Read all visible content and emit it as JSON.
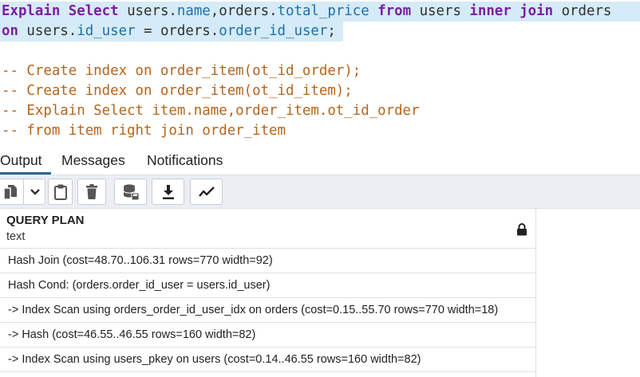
{
  "editor": {
    "line1": {
      "t1": "Explain Select",
      "t2": " users.",
      "t3": "name",
      "t4": ",orders.",
      "t5": "total_price",
      "t6": " ",
      "t7": "from",
      "t8": " users ",
      "t9": "inner join",
      "t10": " orders"
    },
    "line2": {
      "t1": "on",
      "t2": " users.",
      "t3": "id_user",
      "t4": " = orders.",
      "t5": "order_id_user",
      "t6": ";"
    },
    "comment1": "-- Create index on order_item(ot_id_order);",
    "comment2": "-- Create index on order_item(ot_id_item);",
    "comment3": "-- Explain Select item.name,order_item.ot_id_order",
    "comment4": "-- from item right join order_item"
  },
  "tabs": {
    "output": "Output",
    "messages": "Messages",
    "notifications": "Notifications"
  },
  "toolbar": {
    "icons": [
      "copy-icon",
      "chevron-down-icon",
      "paste-icon",
      "delete-icon",
      "save-data-icon",
      "download-icon",
      "graph-icon"
    ]
  },
  "grid": {
    "column": {
      "name": "QUERY PLAN",
      "type": "text"
    },
    "rows": [
      "Hash Join (cost=48.70..106.31 rows=770 width=92)",
      "Hash Cond: (orders.order_id_user = users.id_user)",
      "-> Index Scan using orders_order_id_user_idx on orders (cost=0.15..55.70 rows=770 width=18)",
      "-> Hash (cost=46.55..46.55 rows=160 width=82)",
      "-> Index Scan using users_pkey on users (cost=0.14..46.55 rows=160 width=82)"
    ]
  },
  "colors": {
    "keyword": "#7a1fa2",
    "property": "#1e6fa8",
    "comment": "#b5651d",
    "selection": "#d5ebf7",
    "active_tab": "#326690"
  }
}
